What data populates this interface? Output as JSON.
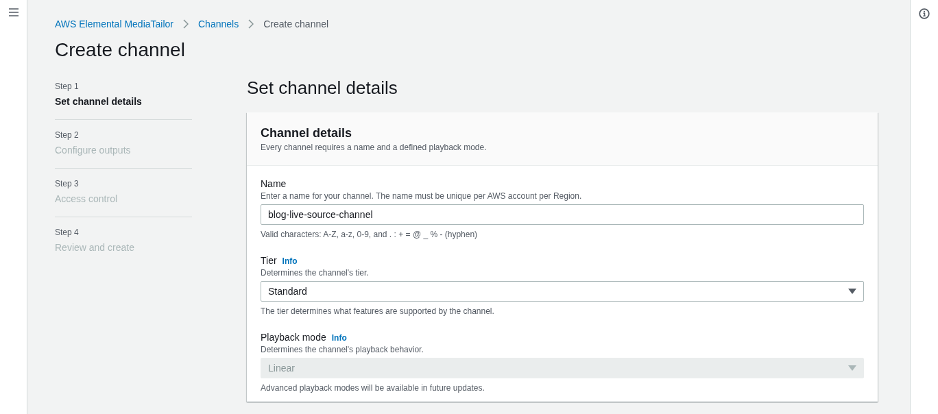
{
  "breadcrumbs": [
    {
      "label": "AWS Elemental MediaTailor",
      "link": true
    },
    {
      "label": "Channels",
      "link": true
    },
    {
      "label": "Create channel",
      "link": false
    }
  ],
  "page_title": "Create channel",
  "steps": [
    {
      "step": "Step 1",
      "title": "Set channel details",
      "selected": true
    },
    {
      "step": "Step 2",
      "title": "Configure outputs",
      "selected": false
    },
    {
      "step": "Step 3",
      "title": "Access control",
      "selected": false
    },
    {
      "step": "Step 4",
      "title": "Review and create",
      "selected": false
    }
  ],
  "section_title": "Set channel details",
  "container": {
    "title": "Channel details",
    "description": "Every channel requires a name and a defined playback mode.",
    "fields": [
      {
        "kind": "text",
        "label": "Name",
        "description": "Enter a name for your channel. The name must be unique per AWS account per Region.",
        "value": "blog-live-source-channel",
        "constraint": "Valid characters: A-Z, a-z, 0-9, and . : + = @ _ % - (hyphen)",
        "disabled": false
      },
      {
        "kind": "select",
        "label": "Tier",
        "info": "Info",
        "description": "Determines the channel's tier.",
        "value": "Standard",
        "constraint": "The tier determines what features are supported by the channel.",
        "disabled": false
      },
      {
        "kind": "select",
        "label": "Playback mode",
        "info": "Info",
        "description": "Determines the channel's playback behavior.",
        "value": "Linear",
        "constraint": "Advanced playback modes will be available in future updates.",
        "disabled": true
      }
    ]
  }
}
